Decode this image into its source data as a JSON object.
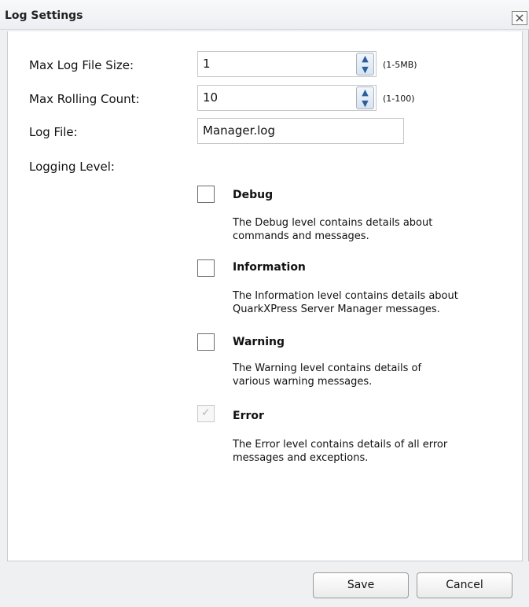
{
  "dialog": {
    "title": "Log Settings",
    "close_glyph": "×"
  },
  "fields": {
    "max_log_file_size": {
      "label": "Max Log File Size:",
      "value": "1",
      "hint": "(1-5MB)"
    },
    "max_rolling_count": {
      "label": "Max Rolling Count:",
      "value": "10",
      "hint": "(1-100)"
    },
    "log_file": {
      "label": "Log File:",
      "value": "Manager.log"
    },
    "logging_level_label": "Logging Level:"
  },
  "levels": [
    {
      "name": "Debug",
      "checked": false,
      "disabled": false,
      "desc_line1": "The Debug level contains details about",
      "desc_line2": "commands and messages."
    },
    {
      "name": "Information",
      "checked": false,
      "disabled": false,
      "desc_line1": "The Information level contains details about",
      "desc_line2": "QuarkXPress Server Manager messages."
    },
    {
      "name": "Warning",
      "checked": false,
      "disabled": false,
      "desc_line1": "The Warning level contains details of",
      "desc_line2": "various warning messages."
    },
    {
      "name": "Error",
      "checked": true,
      "disabled": true,
      "desc_line1": "The Error level contains details of all error",
      "desc_line2": "messages and exceptions."
    }
  ],
  "buttons": {
    "save_label": "Save",
    "cancel_label": "Cancel"
  },
  "icons": {
    "spin_up": "▲",
    "spin_down": "▼",
    "checkmark": "✓"
  }
}
